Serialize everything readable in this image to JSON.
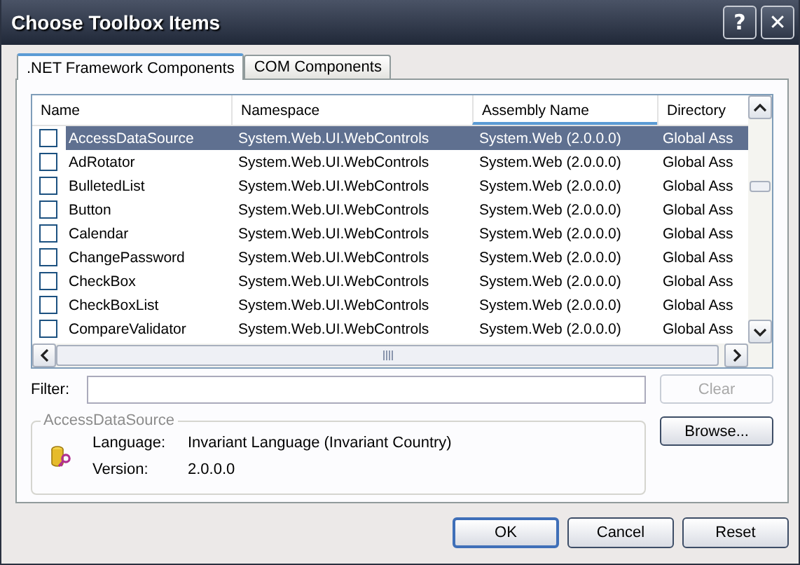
{
  "window": {
    "title": "Choose Toolbox Items",
    "help_button": "?",
    "close_button": "✕"
  },
  "tabs": [
    {
      "label": ".NET Framework Components",
      "selected": true
    },
    {
      "label": "COM Components",
      "selected": false
    }
  ],
  "table": {
    "columns": [
      {
        "label": "Name",
        "sorted": false
      },
      {
        "label": "Namespace",
        "sorted": false
      },
      {
        "label": "Assembly Name",
        "sorted": true
      },
      {
        "label": "Directory",
        "sorted": false
      }
    ],
    "rows": [
      {
        "checked": false,
        "selected": true,
        "cells": [
          "AccessDataSource",
          "System.Web.UI.WebControls",
          "System.Web (2.0.0.0)",
          "Global Ass"
        ]
      },
      {
        "checked": false,
        "selected": false,
        "cells": [
          "AdRotator",
          "System.Web.UI.WebControls",
          "System.Web (2.0.0.0)",
          "Global Ass"
        ]
      },
      {
        "checked": false,
        "selected": false,
        "cells": [
          "BulletedList",
          "System.Web.UI.WebControls",
          "System.Web (2.0.0.0)",
          "Global Ass"
        ]
      },
      {
        "checked": false,
        "selected": false,
        "cells": [
          "Button",
          "System.Web.UI.WebControls",
          "System.Web (2.0.0.0)",
          "Global Ass"
        ]
      },
      {
        "checked": false,
        "selected": false,
        "cells": [
          "Calendar",
          "System.Web.UI.WebControls",
          "System.Web (2.0.0.0)",
          "Global Ass"
        ]
      },
      {
        "checked": false,
        "selected": false,
        "cells": [
          "ChangePassword",
          "System.Web.UI.WebControls",
          "System.Web (2.0.0.0)",
          "Global Ass"
        ]
      },
      {
        "checked": false,
        "selected": false,
        "cells": [
          "CheckBox",
          "System.Web.UI.WebControls",
          "System.Web (2.0.0.0)",
          "Global Ass"
        ]
      },
      {
        "checked": false,
        "selected": false,
        "cells": [
          "CheckBoxList",
          "System.Web.UI.WebControls",
          "System.Web (2.0.0.0)",
          "Global Ass"
        ]
      },
      {
        "checked": false,
        "selected": false,
        "cells": [
          "CompareValidator",
          "System.Web.UI.WebControls",
          "System.Web (2.0.0.0)",
          "Global Ass"
        ]
      }
    ]
  },
  "filter": {
    "label": "Filter:",
    "clear_button": {
      "label": "Clear",
      "disabled": true
    }
  },
  "details": {
    "title": "AccessDataSource",
    "fields": [
      {
        "label": "Language:",
        "value": "Invariant Language (Invariant Country)"
      },
      {
        "label": "Version:",
        "value": "2.0.0.0"
      }
    ]
  },
  "browse_button": "Browse...",
  "buttons": [
    {
      "label": "OK",
      "default": true
    },
    {
      "label": "Cancel",
      "default": false
    },
    {
      "label": "Reset",
      "default": false
    }
  ]
}
